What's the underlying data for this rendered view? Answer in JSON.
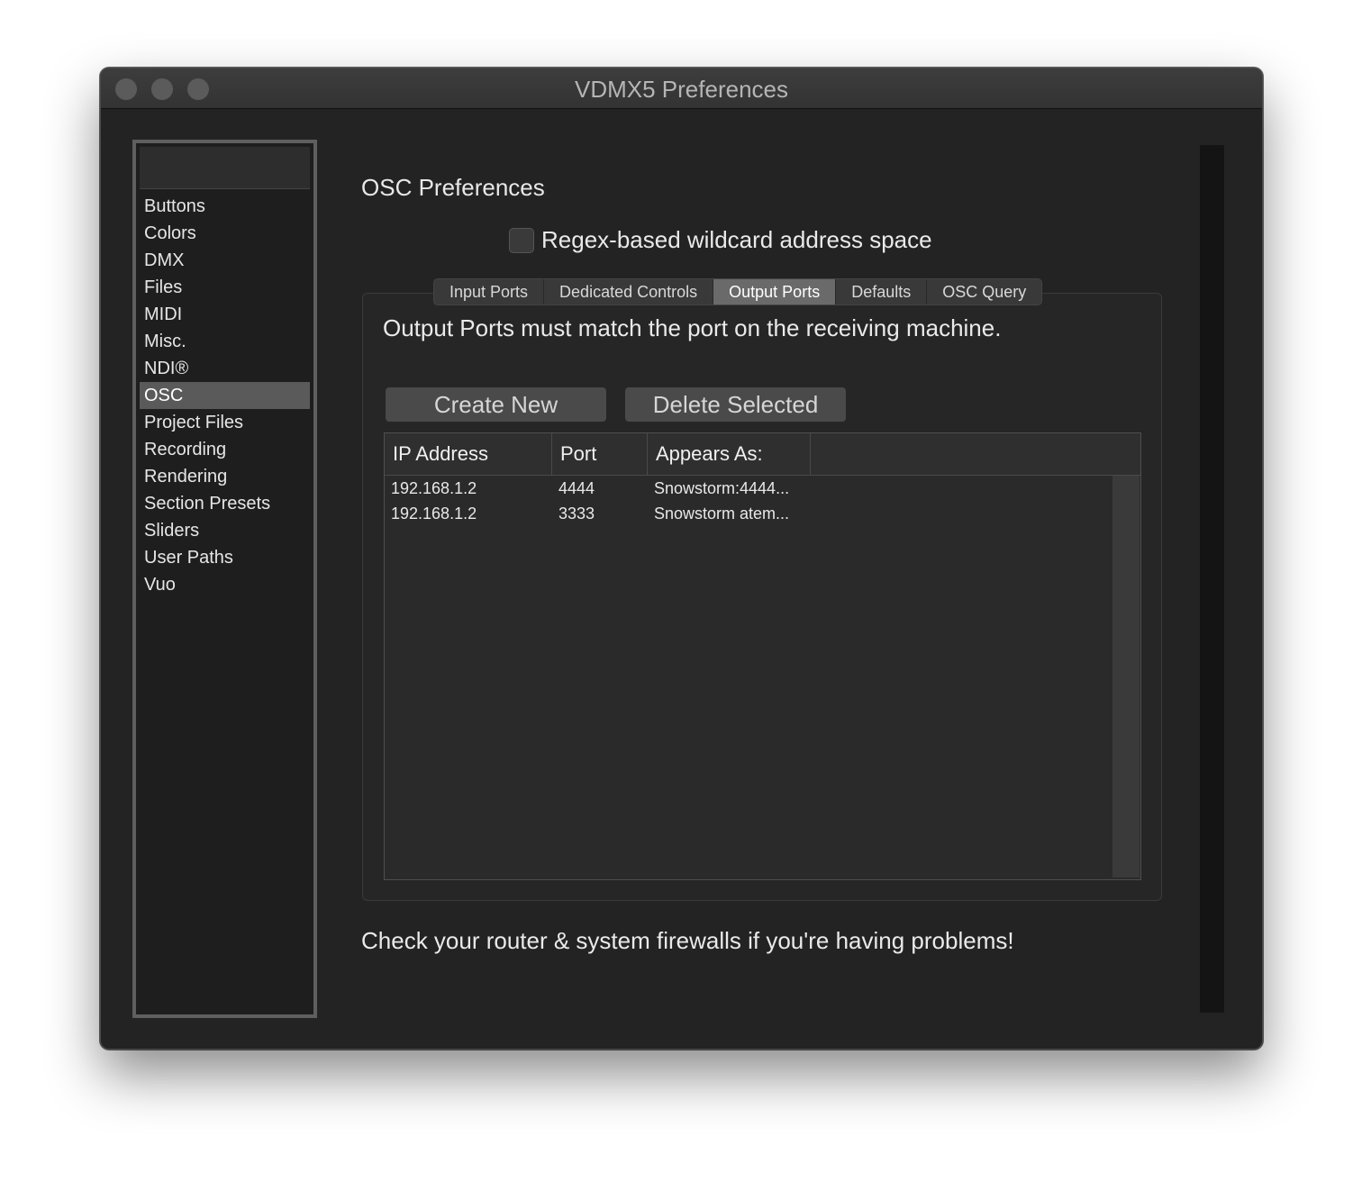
{
  "window": {
    "title": "VDMX5 Preferences"
  },
  "sidebar": {
    "items": [
      {
        "label": "Buttons"
      },
      {
        "label": "Colors"
      },
      {
        "label": "DMX"
      },
      {
        "label": "Files"
      },
      {
        "label": "MIDI"
      },
      {
        "label": "Misc."
      },
      {
        "label": "NDI®"
      },
      {
        "label": "OSC",
        "selected": true
      },
      {
        "label": "Project Files"
      },
      {
        "label": "Recording"
      },
      {
        "label": "Rendering"
      },
      {
        "label": "Section Presets"
      },
      {
        "label": "Sliders"
      },
      {
        "label": "User Paths"
      },
      {
        "label": "Vuo"
      }
    ]
  },
  "main": {
    "heading": "OSC Preferences",
    "regex_checkbox": {
      "label": "Regex-based wildcard address space",
      "checked": false
    },
    "tabs": [
      {
        "label": "Input Ports"
      },
      {
        "label": "Dedicated Controls"
      },
      {
        "label": "Output Ports",
        "active": true
      },
      {
        "label": "Defaults"
      },
      {
        "label": "OSC Query"
      }
    ],
    "hint": "Output Ports must match the port on the receiving machine.",
    "create_button": "Create New",
    "delete_button": "Delete Selected",
    "table": {
      "columns": [
        "IP Address",
        "Port",
        "Appears As:"
      ],
      "rows": [
        {
          "ip": "192.168.1.2",
          "port": "4444",
          "appears_as": "Snowstorm:4444..."
        },
        {
          "ip": "192.168.1.2",
          "port": "3333",
          "appears_as": "Snowstorm atem..."
        }
      ]
    },
    "footer": "Check your router & system firewalls if you're having problems!"
  }
}
